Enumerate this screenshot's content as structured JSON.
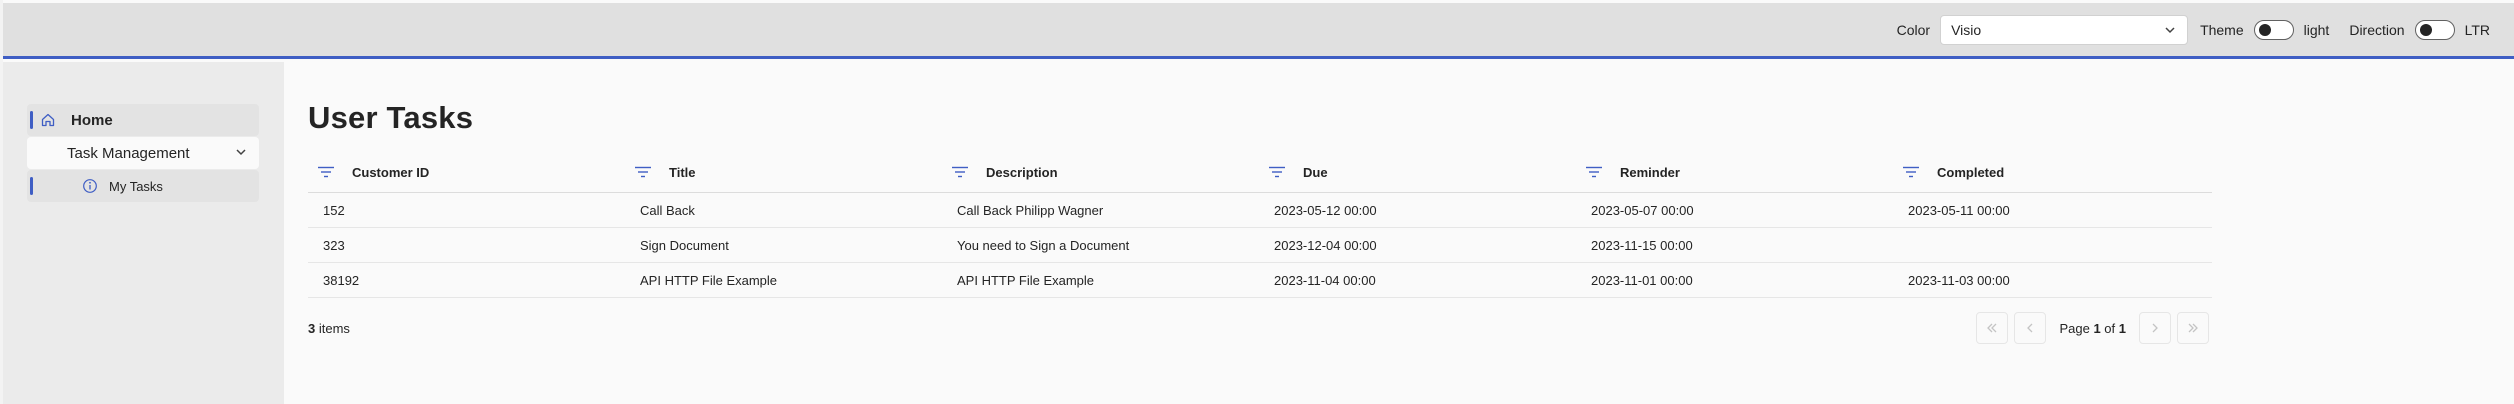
{
  "header": {
    "color_label": "Color",
    "color_value": "Visio",
    "theme_label": "Theme",
    "theme_value": "light",
    "direction_label": "Direction",
    "direction_value": "LTR"
  },
  "sidebar": {
    "items": [
      {
        "label": "Home",
        "icon": "home-icon"
      },
      {
        "label": "Task Management",
        "icon": "chevron-down-icon"
      },
      {
        "label": "My Tasks",
        "icon": "info-icon"
      }
    ]
  },
  "page": {
    "title": "User Tasks"
  },
  "table": {
    "columns": [
      "Customer ID",
      "Title",
      "Description",
      "Due",
      "Reminder",
      "Completed"
    ],
    "rows": [
      [
        "152",
        "Call Back",
        "Call Back Philipp Wagner",
        "2023-05-12 00:00",
        "2023-05-07 00:00",
        "2023-05-11 00:00"
      ],
      [
        "323",
        "Sign Document",
        "You need to Sign a Document",
        "2023-12-04 00:00",
        "2023-11-15 00:00",
        ""
      ],
      [
        "38192",
        "API HTTP File Example",
        "API HTTP File Example",
        "2023-11-04 00:00",
        "2023-11-01 00:00",
        "2023-11-03 00:00"
      ]
    ]
  },
  "footer": {
    "item_count": "3",
    "items_label": "items",
    "page_label": "Page",
    "page_current": "1",
    "of_label": "of",
    "page_total": "1"
  },
  "colors": {
    "accent": "#3f5ec4",
    "header_bg": "#e0e0e0",
    "sidebar_bg": "#ebebeb"
  }
}
